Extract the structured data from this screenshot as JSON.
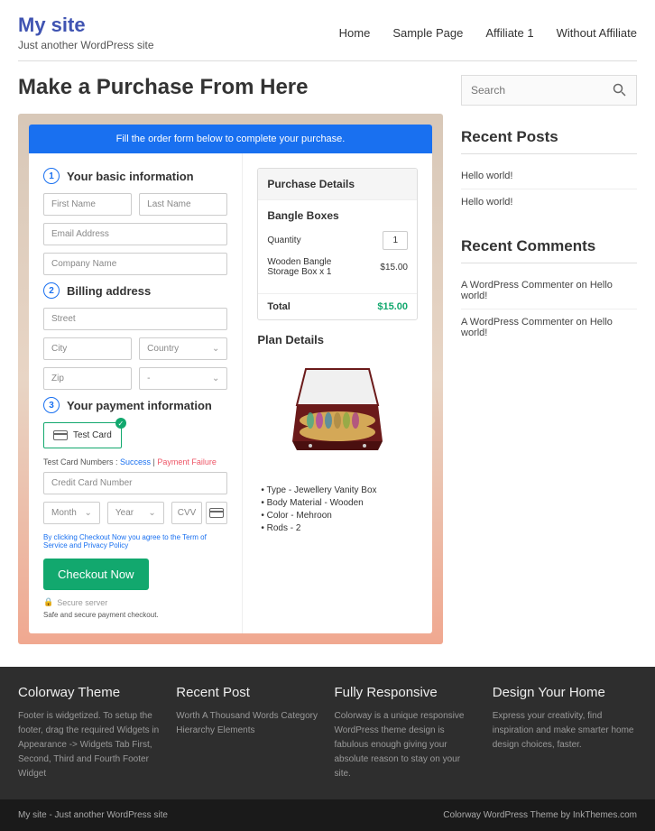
{
  "site": {
    "title": "My site",
    "tagline": "Just another WordPress site"
  },
  "nav": [
    "Home",
    "Sample Page",
    "Affiliate 1",
    "Without Affiliate"
  ],
  "page_title": "Make a Purchase From Here",
  "banner": "Fill the order form below to complete your purchase.",
  "s1": {
    "n": "1",
    "t": "Your basic information"
  },
  "s2": {
    "n": "2",
    "t": "Billing address"
  },
  "s3": {
    "n": "3",
    "t": "Your payment information"
  },
  "ph": {
    "first": "First Name",
    "last": "Last Name",
    "email": "Email Address",
    "company": "Company Name",
    "street": "Street",
    "city": "City",
    "country": "Country",
    "zip": "Zip",
    "state": "-",
    "cc": "Credit Card Number",
    "month": "Month",
    "year": "Year",
    "cvv": "CVV"
  },
  "testcard": "Test Card",
  "testnote_pre": "Test Card Numbers : ",
  "testnote_s": "Success",
  "testnote_sep": " | ",
  "testnote_f": "Payment Failure",
  "terms_pre": "By clicking Checkout Now you agree to the ",
  "terms_tos": "Term of Service",
  "terms_and": " and ",
  "terms_pp": "Privacy Policy",
  "checkout": "Checkout Now",
  "secure": "Secure server",
  "safe": "Safe and secure payment checkout.",
  "pd": {
    "head": "Purchase Details",
    "title": "Bangle Boxes",
    "qty_label": "Quantity",
    "qty": "1",
    "item": "Wooden Bangle Storage Box x 1",
    "item_price": "$15.00",
    "total_label": "Total",
    "total": "$15.00"
  },
  "plan": {
    "title": "Plan Details",
    "details": [
      "Type - Jewellery Vanity Box",
      "Body Material - Wooden",
      "Color - Mehroon",
      "Rods - 2"
    ]
  },
  "sidebar": {
    "search": "Search",
    "recent_posts": {
      "title": "Recent Posts",
      "items": [
        "Hello world!",
        "Hello world!"
      ]
    },
    "recent_comments": {
      "title": "Recent Comments",
      "items": [
        "A WordPress Commenter on Hello world!",
        "A WordPress Commenter on Hello world!"
      ]
    }
  },
  "footer": {
    "cols": [
      {
        "title": "Colorway Theme",
        "text": "Footer is widgetized. To setup the footer, drag the required Widgets in Appearance -> Widgets Tab First, Second, Third and Fourth Footer Widget"
      },
      {
        "title": "Recent Post",
        "text": "Worth A Thousand Words Category Hierarchy Elements"
      },
      {
        "title": "Fully Responsive",
        "text": "Colorway is a unique responsive WordPress theme design is fabulous enough giving your absolute reason to stay on your site."
      },
      {
        "title": "Design Your Home",
        "text": "Express your creativity, find inspiration and make smarter home design choices, faster."
      }
    ],
    "bar_left": "My site - Just another WordPress site",
    "bar_right": "Colorway WordPress Theme by InkThemes.com"
  }
}
